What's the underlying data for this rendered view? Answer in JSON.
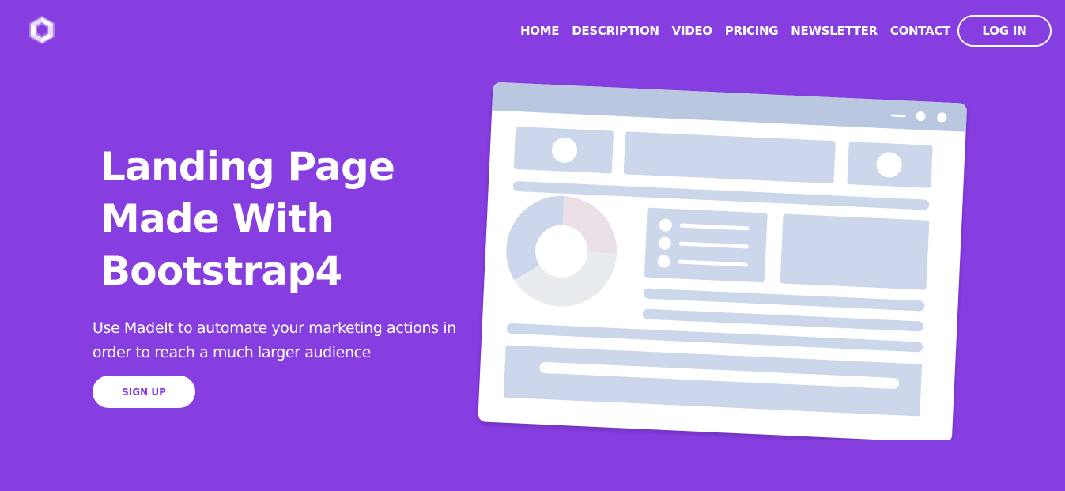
{
  "header": {
    "logo_icon": "hexagon-swirl-logo-icon",
    "nav": [
      {
        "label": "HOME"
      },
      {
        "label": "DESCRIPTION"
      },
      {
        "label": "VIDEO"
      },
      {
        "label": "PRICING"
      },
      {
        "label": "NEWSLETTER"
      },
      {
        "label": "CONTACT"
      }
    ],
    "login_label": "LOG IN"
  },
  "hero": {
    "title_lines": [
      "Landing Page",
      "Made With",
      "Bootstrap4"
    ],
    "subtitle": "Use MadeIt to automate your marketing actions in order to reach a much larger audience",
    "signup_label": "SIGN UP",
    "illustration_icon": "dashboard-window-illustration"
  },
  "colors": {
    "background": "#873ee0",
    "button_text": "#873ee0",
    "white": "#ffffff",
    "window_bar": "#b9c7e0",
    "placeholder": "#ccd7ec"
  }
}
